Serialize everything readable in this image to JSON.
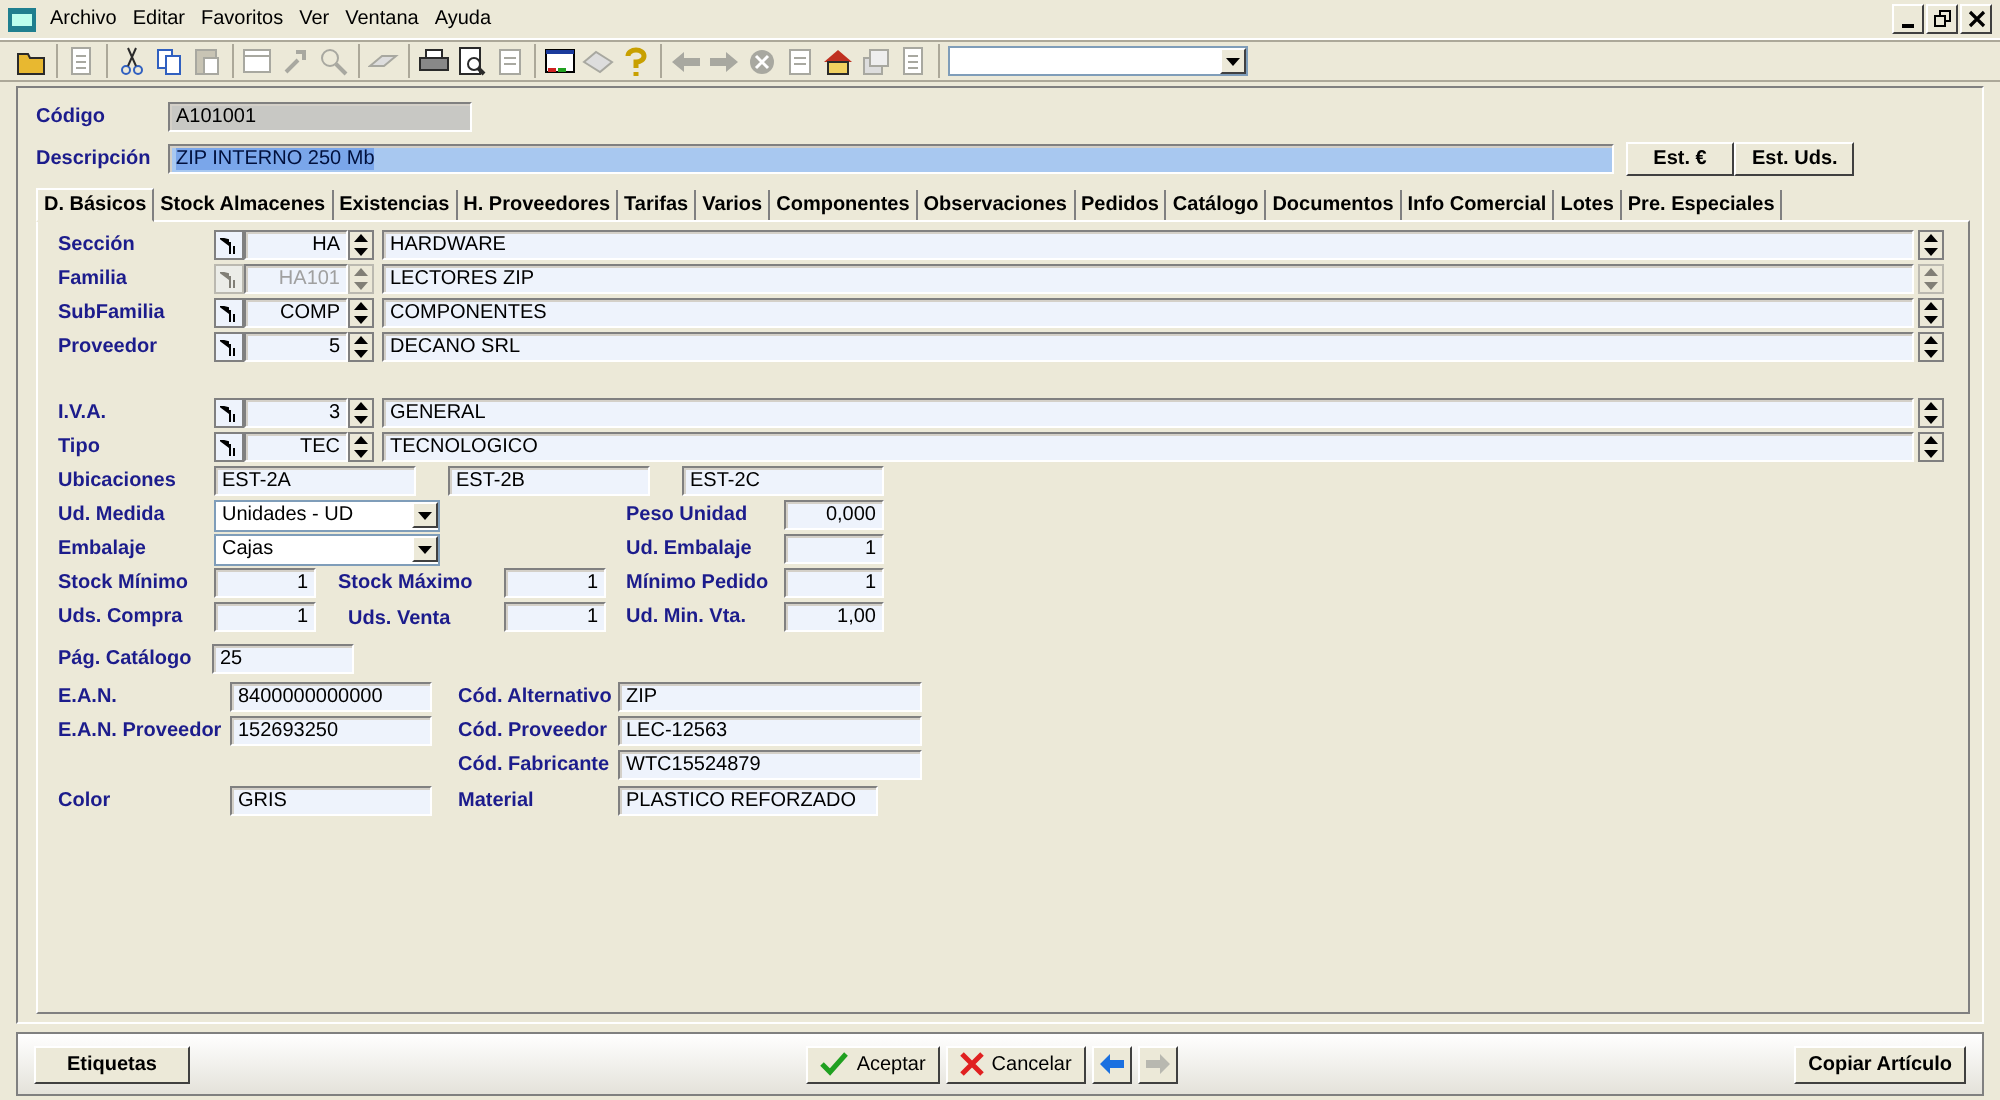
{
  "menu": [
    {
      "label": "Archivo"
    },
    {
      "label": "Editar"
    },
    {
      "label": "Favoritos"
    },
    {
      "label": "Ver"
    },
    {
      "label": "Ventana"
    },
    {
      "label": "Ayuda"
    }
  ],
  "toolbar": [
    [
      {
        "kind": "open",
        "disabled": false
      }
    ],
    [
      {
        "kind": "edit",
        "disabled": true
      }
    ],
    [
      {
        "kind": "cut",
        "disabled": false
      },
      {
        "kind": "copy",
        "disabled": false
      },
      {
        "kind": "paste",
        "disabled": true
      }
    ],
    [
      {
        "kind": "window",
        "disabled": true
      },
      {
        "kind": "tool",
        "disabled": true
      },
      {
        "kind": "find",
        "disabled": true
      }
    ],
    [
      {
        "kind": "eraser",
        "disabled": true
      }
    ],
    [
      {
        "kind": "print",
        "disabled": false
      },
      {
        "kind": "preview",
        "disabled": false
      },
      {
        "kind": "page",
        "disabled": true
      }
    ],
    [
      {
        "kind": "screen",
        "disabled": false
      },
      {
        "kind": "tag",
        "disabled": true
      },
      {
        "kind": "help",
        "disabled": false
      }
    ],
    [
      {
        "kind": "back",
        "disabled": true
      },
      {
        "kind": "forward",
        "disabled": true
      },
      {
        "kind": "stop",
        "disabled": true
      },
      {
        "kind": "page",
        "disabled": true
      },
      {
        "kind": "home",
        "disabled": false
      },
      {
        "kind": "stack",
        "disabled": true
      },
      {
        "kind": "edit",
        "disabled": true
      }
    ]
  ],
  "codigo": {
    "label": "Código",
    "value": "A101001"
  },
  "descripcion": {
    "label": "Descripción",
    "value": "ZIP INTERNO 250 Mb",
    "selected": true
  },
  "header_buttons": [
    "Est. €",
    "Est. Uds."
  ],
  "tabs": [
    {
      "label": "D. Básicos",
      "selected": true
    },
    {
      "label": "Stock Almacenes",
      "selected": false
    },
    {
      "label": "Existencias",
      "selected": false
    },
    {
      "label": "H. Proveedores",
      "selected": false
    },
    {
      "label": "Tarifas",
      "selected": false
    },
    {
      "label": "Varios",
      "selected": false
    },
    {
      "label": "Componentes",
      "selected": false
    },
    {
      "label": "Observaciones",
      "selected": false
    },
    {
      "label": "Pedidos",
      "selected": false
    },
    {
      "label": "Catálogo",
      "selected": false
    },
    {
      "label": "Documentos",
      "selected": false
    },
    {
      "label": "Info Comercial",
      "selected": false
    },
    {
      "label": "Lotes",
      "selected": false
    },
    {
      "label": "Pre. Especiales",
      "selected": false
    }
  ],
  "lookups": [
    {
      "label": "Sección",
      "code": "HA",
      "name": "HARDWARE",
      "disabled": false
    },
    {
      "label": "Familia",
      "code": "HA101",
      "name": "LECTORES ZIP",
      "disabled": true
    },
    {
      "label": "SubFamilia",
      "code": "COMP",
      "name": "COMPONENTES",
      "disabled": false
    },
    {
      "label": "Proveedor",
      "code": "5",
      "name": "DECANO SRL",
      "disabled": false
    }
  ],
  "lookups_tax": [
    {
      "label": "I.V.A.",
      "code": "3",
      "name": "GENERAL",
      "disabled": false
    },
    {
      "label": "Tipo",
      "code": "TEC",
      "name": "TECNOLOGICO",
      "disabled": false
    }
  ],
  "ubicaciones": {
    "label": "Ubicaciones",
    "values": [
      "EST-2A",
      "EST-2B",
      "EST-2C"
    ]
  },
  "ud_medida": {
    "label": "Ud. Medida",
    "value": "Unidades - UD"
  },
  "peso_unidad": {
    "label": "Peso Unidad",
    "value": "0,000"
  },
  "embalaje": {
    "label": "Embalaje",
    "value": "Cajas"
  },
  "ud_embalaje": {
    "label": "Ud. Embalaje",
    "value": "1"
  },
  "stock_minimo": {
    "label": "Stock Mínimo",
    "value": "1"
  },
  "stock_maximo": {
    "label": "Stock Máximo",
    "value": "1"
  },
  "minimo_pedido": {
    "label": "Mínimo Pedido",
    "value": "1"
  },
  "uds_compra": {
    "label": "Uds. Compra",
    "value": "1"
  },
  "uds_venta": {
    "label": "Uds. Venta",
    "value": "1"
  },
  "ud_min_vta": {
    "label": "Ud. Min. Vta.",
    "value": "1,00"
  },
  "pag_catalogo": {
    "label": "Pág. Catálogo",
    "value": "25"
  },
  "ean": {
    "label": "E.A.N.",
    "value": "8400000000000"
  },
  "cod_alternativo": {
    "label": "Cód. Alternativo",
    "value": "ZIP"
  },
  "ean_proveedor": {
    "label": "E.A.N. Proveedor",
    "value": "152693250"
  },
  "cod_proveedor": {
    "label": "Cód. Proveedor",
    "value": "LEC-12563"
  },
  "cod_fabricante": {
    "label": "Cód. Fabricante",
    "value": "WTC15524879"
  },
  "color": {
    "label": "Color",
    "value": "GRIS"
  },
  "material": {
    "label": "Material",
    "value": "PLASTICO REFORZADO"
  },
  "footer": {
    "labels_button": "Etiquetas",
    "accept": "Aceptar",
    "cancel": "Cancelar",
    "back_disabled": false,
    "forward_disabled": true,
    "copy_button": "Copiar Artículo"
  }
}
